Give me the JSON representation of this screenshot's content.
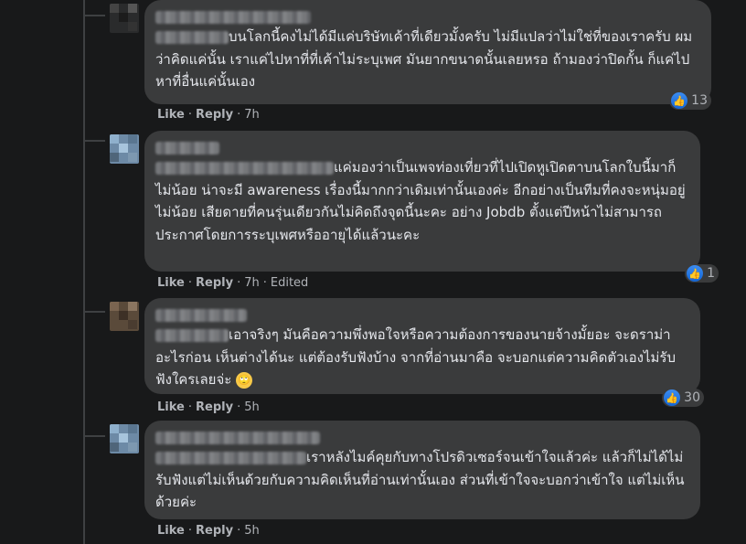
{
  "comments": [
    {
      "text": "บนโลกนี้คงไม่ได้มีแค่บริษัทเค้าที่เดียวมั้งครับ ไม่มีแปลว่าไม่ใช่ที่ของเราครับ ผมว่าคิดแค่นั้น เราแค่ไปหาที่ที่เค้าไม่ระบุเพศ มันยากขนาดนั้นเลยหรอ ถ้ามองว่าปิดกั้น ก็แค่ไปหาที่อื่นแค่นั้นเอง",
      "like": "Like",
      "reply": "Reply",
      "time": "7h",
      "edited": "",
      "reaction_count": "13"
    },
    {
      "text": "แค่มองว่าเป็นเพจท่องเที่ยวที่ไปเปิดหูเปิดตาบนโลกใบนี้มาก็ไม่น้อย น่าจะมี awareness เรื่องนี้มากกว่าเดิมเท่านั้นเองค่ะ อีกอย่างเป็นทีมที่คงจะหนุ่มอยู่ไม่น้อย เสียดายที่คนรุ่นเดียวกันไม่คิดถึงจุดนี้นะคะ อย่าง Jobdb ตั้งแต่ปีหน้าไม่สามารถประกาศโดยการระบุเพศหรืออายุได้แล้วนะคะ",
      "like": "Like",
      "reply": "Reply",
      "time": "7h",
      "edited": "Edited",
      "reaction_count": "1"
    },
    {
      "text": "เอาจริงๆ มันคือความพึ่งพอใจหรือความต้องการของนายจ้างมั้ยอะ จะดราม่าอะไรก่อน เห็นต่างได้นะ แต่ต้องรับฟังบ้าง จากที่อ่านมาคือ จะบอกแต่ความคิดตัวเองไม่รับฟังใครเลยจ่ะ",
      "like": "Like",
      "reply": "Reply",
      "time": "5h",
      "edited": "",
      "reaction_count": "30"
    },
    {
      "text": "เราหลังไมค์คุยกับทางโปรดิวเซอร์จนเข้าใจแล้วค่ะ แล้วก็ไม่ได้ไม่รับฟังแต่ไม่เห็นด้วยกับความคิดเห็นที่อ่านเท่านั้นเอง ส่วนที่เข้าใจจะบอกว่าเข้าใจ แต่ไม่เห็นด้วยค่ะ",
      "like": "Like",
      "reply": "Reply",
      "time": "5h",
      "edited": "",
      "reaction_count": ""
    }
  ],
  "icons": {
    "like": "thumbs-up-icon",
    "emoji": "rolling-eyes-emoji"
  },
  "colors": {
    "background": "#18191a",
    "bubble": "#3a3b3c",
    "like_blue": "#1877f2"
  }
}
